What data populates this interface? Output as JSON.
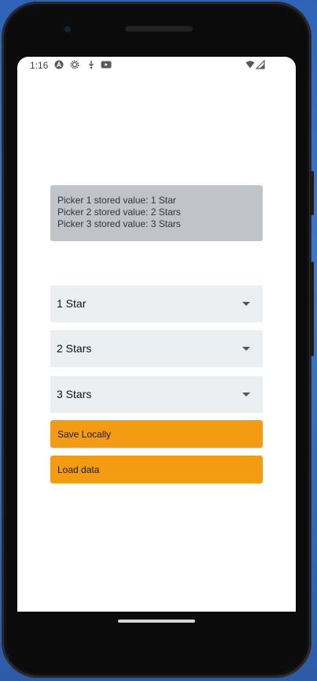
{
  "status_bar": {
    "time": "1:16",
    "icons": [
      "app-a-icon",
      "gear-icon",
      "download-icon",
      "youtube-icon",
      "wifi-icon",
      "signal-icon"
    ]
  },
  "stored_values": {
    "line1": "Picker 1 stored value: 1 Star",
    "line2": "Picker 2 stored value: 2 Stars",
    "line3": "Picker 3 stored value: 3 Stars"
  },
  "pickers": [
    {
      "selected": "1 Star"
    },
    {
      "selected": "2 Stars"
    },
    {
      "selected": "3 Stars"
    }
  ],
  "buttons": {
    "save_label": "Save Locally",
    "load_label": "Load data"
  },
  "colors": {
    "button": "#f39c12",
    "stored_box": "#c0c4c8",
    "picker_bg": "#eceff1"
  }
}
